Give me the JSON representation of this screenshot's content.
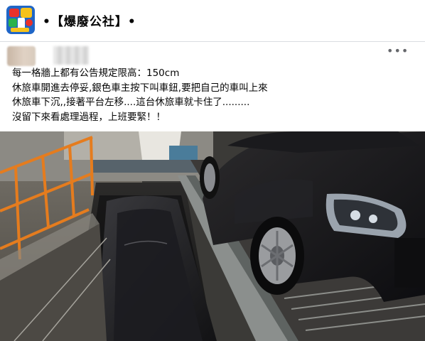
{
  "group": {
    "name": "•【爆廢公社】•",
    "logo_icon": "bao-fei-gong-she-logo"
  },
  "post": {
    "more_icon": "more-horizontal-icon",
    "more_label": "•••",
    "lines": [
      "每一格牆上都有公告規定限高：150cm",
      "休旅車開進去停妥,銀色車主按下叫車鈕,要把自己的車叫上來",
      "休旅車下沉,,接著平台左移....這台休旅車就卡住了.........",
      "沒留下來看處理過程，上班要緊！！"
    ],
    "photo_subject": "mechanical-parking-car-stuck"
  },
  "colors": {
    "background": "#f0f2f5",
    "card": "#ffffff",
    "text": "#050505",
    "muted": "#65676b",
    "railing_orange": "#e57c1e"
  }
}
